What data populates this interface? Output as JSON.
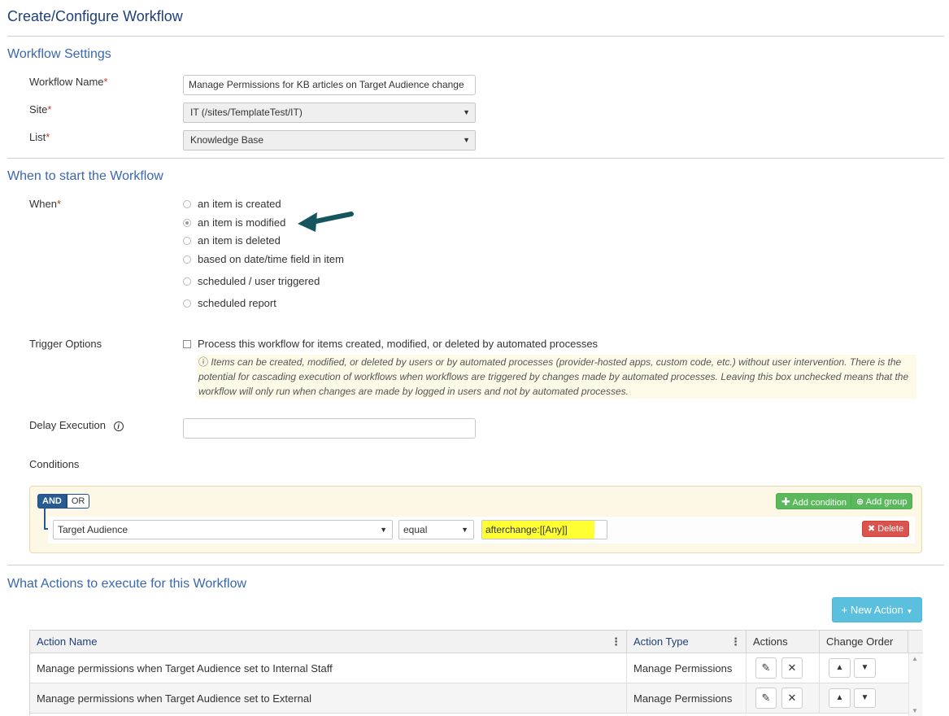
{
  "page_title": "Create/Configure Workflow",
  "settings": {
    "section_title": "Workflow Settings",
    "name_label": "Workflow Name",
    "name_value": "Manage Permissions for KB articles on Target Audience change",
    "site_label": "Site",
    "site_value": "IT (/sites/TemplateTest/IT)",
    "list_label": "List",
    "list_value": "Knowledge Base",
    "required_mark": "*"
  },
  "start": {
    "section_title": "When to start the Workflow",
    "when_label": "When",
    "options": [
      {
        "label": "an item is created",
        "checked": false
      },
      {
        "label": "an item is modified",
        "checked": true
      },
      {
        "label": "an item is deleted",
        "checked": false
      },
      {
        "label": "based on date/time field in item",
        "checked": false
      },
      {
        "label": "scheduled / user triggered",
        "checked": false
      },
      {
        "label": "scheduled report",
        "checked": false
      }
    ],
    "trigger_label": "Trigger Options",
    "trigger_checkbox": "Process this workflow for items created, modified, or deleted by automated processes",
    "trigger_note": "Items can be created, modified, or deleted by users or by automated processes (provider-hosted apps, custom code, etc.) without user intervention. There is the potential for cascading execution of workflows when workflows are triggered by changes made by automated processes. Leaving this box unchecked means that the workflow will only run when changes are made by logged in users and not by automated processes.",
    "delay_label": "Delay Execution",
    "delay_value": "",
    "conditions_label": "Conditions"
  },
  "conditions": {
    "and_label": "AND",
    "or_label": "OR",
    "add_condition": "Add condition",
    "add_group": "Add group",
    "field": "Target Audience",
    "operator": "equal",
    "value": "afterchange:[[Any]]",
    "delete_label": "Delete"
  },
  "actions": {
    "section_title": "What Actions to execute for this Workflow",
    "new_action": "New Action",
    "columns": [
      "Action Name",
      "Action Type",
      "Actions",
      "Change Order"
    ],
    "rows": [
      {
        "name": "Manage permissions when Target Audience set to Internal Staff",
        "type": "Manage Permissions"
      },
      {
        "name": "Manage permissions when Target Audience set to External",
        "type": "Manage Permissions"
      }
    ]
  },
  "colors": {
    "title": "#1f3f77",
    "section": "#3a67b0",
    "arrow": "#17555e",
    "highlight": "#ffff33"
  }
}
